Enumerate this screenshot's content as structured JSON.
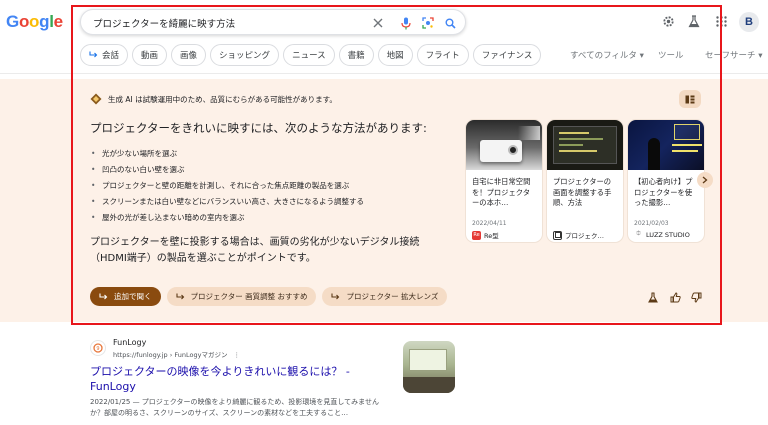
{
  "header": {
    "logo": "Google",
    "search_query": "プロジェクターを綺麗に映す方法",
    "avatar_letter": "B",
    "icons": [
      "clear-icon",
      "mic-icon",
      "lens-icon",
      "search-icon",
      "gear-icon",
      "labs-icon",
      "apps-icon"
    ]
  },
  "chips": [
    {
      "label": "会話",
      "icon": "arrow-return-icon"
    },
    {
      "label": "動画"
    },
    {
      "label": "画像"
    },
    {
      "label": "ショッピング"
    },
    {
      "label": "ニュース"
    },
    {
      "label": "書籍"
    },
    {
      "label": "地図"
    },
    {
      "label": "フライト"
    },
    {
      "label": "ファイナンス"
    }
  ],
  "tools": {
    "all_filters": "すべてのフィルタ ▾",
    "tools": "ツール",
    "safe_search": "セーフサーチ ▾"
  },
  "ai_overview": {
    "notice": "生成 AI は試験運用中のため、品質にむらがある可能性があります。",
    "heading": "プロジェクターをきれいに映すには、次のような方法があります:",
    "bullets": [
      "光が少ない場所を選ぶ",
      "凹凸のない白い壁を選ぶ",
      "プロジェクターと壁の距離を計測し、それに合った焦点距離の製品を選ぶ",
      "スクリーンまたは白い壁などにバランスいい高さ、大きさになるよう調整する",
      "屋外の光が差し込まない暗めの室内を選ぶ"
    ],
    "paragraph": "プロジェクターを壁に投影する場合は、画質の劣化が少ないデジタル接続（HDMI端子）の製品を選ぶことがポイントです。",
    "buttons": {
      "follow_up": "追加で聞く",
      "suggest_1": "プロジェクター 画質調整 おすすめ",
      "suggest_2": "プロジェクター 拡大レンズ"
    },
    "cards": [
      {
        "title": "自宅に非日常空間を！プロジェクターの本ホ…",
        "date": "2022/04/11",
        "source": "Re型",
        "logo_color": "#e53935",
        "logo_text": "Re"
      },
      {
        "title": "プロジェクターの画面を調整する手順、方法",
        "date": "",
        "source": "プロジェク…",
        "logo_color": "#333333",
        "logo_text": ""
      },
      {
        "title": "【初心者向け】プロジェクターを使った撮影…",
        "date": "2021/02/03",
        "source": "LUZZ STUDIO",
        "logo_color": "#ffffff",
        "logo_text": ""
      }
    ]
  },
  "result": {
    "site_name": "FunLogy",
    "url": "https://funlogy.jp › FunLogyマガジン",
    "title": "プロジェクターの映像を今よりきれいに観るには？ - FunLogy",
    "snippet": "2022/01/25 — プロジェクターの映像をより綺麗に観るため、投影環境を見直してみませんか？部屋の明るさ、スクリーンのサイズ、スクリーンの素材などを工夫すること…"
  },
  "colors": {
    "ai_bg": "#fdf1e8",
    "primary_btn": "#8a4b0f",
    "link": "#1a0dab",
    "frame": "#e8161b"
  }
}
